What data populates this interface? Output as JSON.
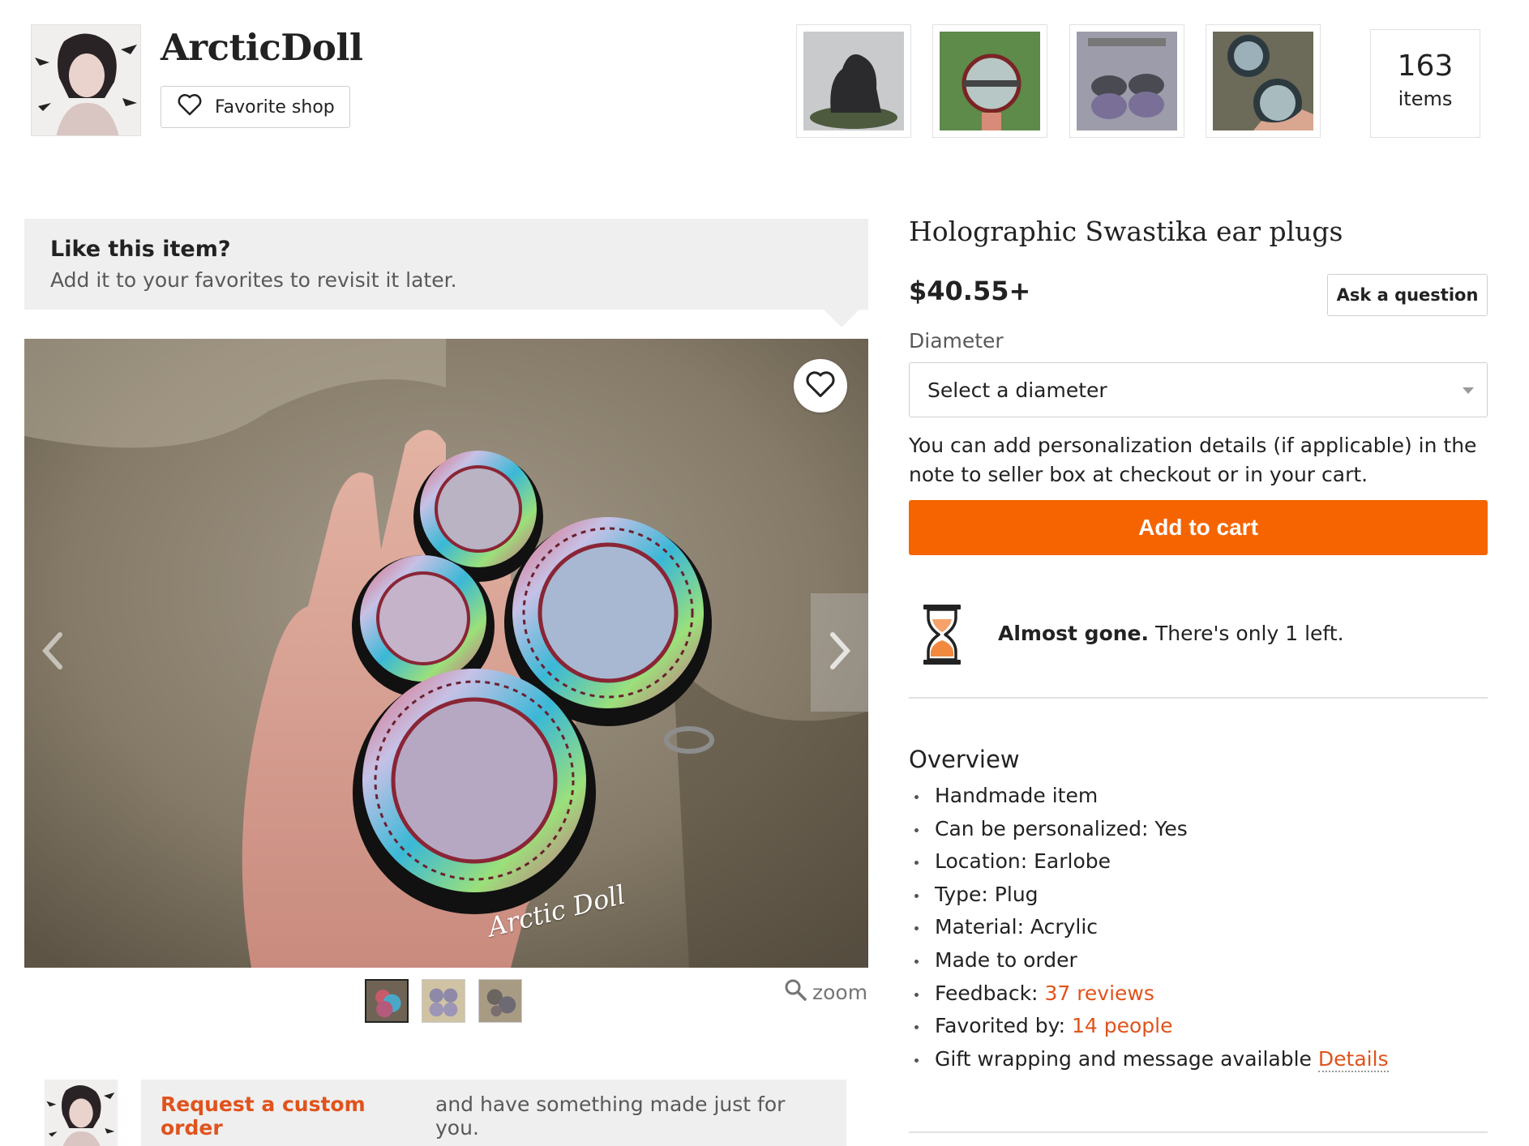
{
  "shop": {
    "name": "ArcticDoll",
    "favorite_label": "Favorite shop",
    "items_count": "163",
    "items_label": "items"
  },
  "banner": {
    "title": "Like this item?",
    "subtitle": "Add it to your favorites to revisit it later."
  },
  "image": {
    "watermark": "Arctic Doll",
    "zoom_label": "zoom"
  },
  "custom_order": {
    "link": "Request a custom order",
    "text": "and have something made just for you."
  },
  "listing": {
    "title": "Holographic Swastika ear plugs",
    "price": "$40.55+",
    "ask_label": "Ask a question",
    "diameter_label": "Diameter",
    "diameter_placeholder": "Select a diameter",
    "personalization_note": "You can add personalization details (if applicable) in the note to seller box at checkout or in your cart.",
    "add_to_cart": "Add to cart",
    "almost_gone": "Almost gone.",
    "stock_text": "There's only 1 left."
  },
  "overview": {
    "title": "Overview",
    "items": [
      "Handmade item",
      "Can be personalized: Yes",
      "Location: Earlobe",
      "Type: Plug",
      "Material: Acrylic",
      "Made to order"
    ],
    "feedback_label": "Feedback:",
    "feedback_link": "37 reviews",
    "favorited_label": "Favorited by:",
    "favorited_link": "14 people",
    "gift_label": "Gift wrapping and message available",
    "gift_link": "Details"
  },
  "colors": {
    "accent_orange": "#f56400",
    "link_orange": "#e0531c"
  }
}
